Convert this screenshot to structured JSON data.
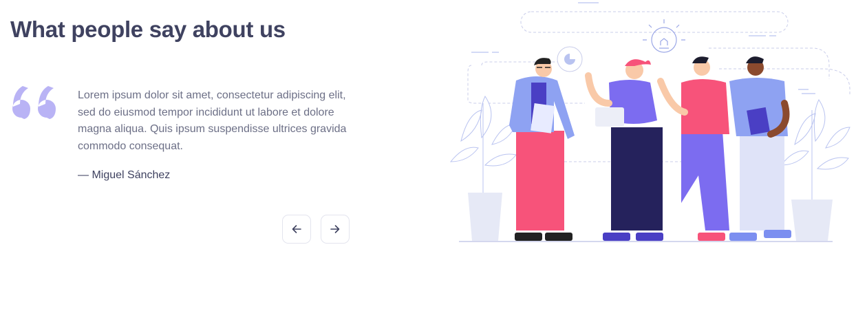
{
  "section": {
    "title": "What people say about us"
  },
  "testimonial": {
    "quote": "Lorem ipsum dolor sit amet, consectetur adipiscing elit, sed do eiusmod tempor incididunt ut labore et dolore magna aliqua. Quis ipsum suspendisse ultrices gravida commodo consequat.",
    "author": "— Miguel Sánchez"
  },
  "navigation": {
    "prev_icon": "arrow-left-icon",
    "next_icon": "arrow-right-icon"
  },
  "colors": {
    "heading": "#3f4260",
    "body_text": "#6c6f86",
    "quote_mark": "#b9b3f5",
    "accent_pink": "#f7537a",
    "accent_purple": "#7c6cf0",
    "navy": "#25225c"
  }
}
